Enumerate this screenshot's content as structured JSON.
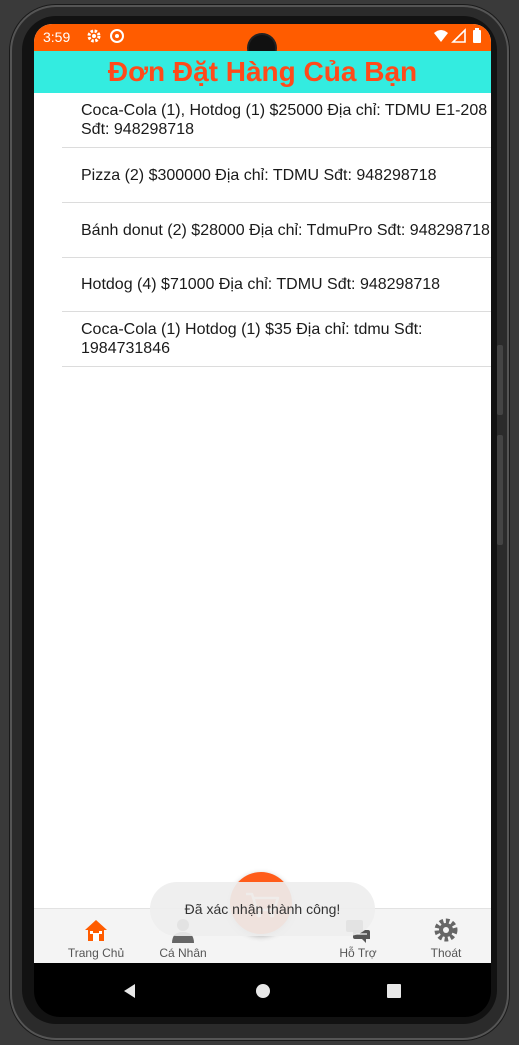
{
  "status_bar": {
    "time": "3:59"
  },
  "app_bar": {
    "title": "Đơn Đặt Hàng Của Bạn"
  },
  "orders": [
    {
      "text": "Coca-Cola (1), Hotdog (1) $25000 Địa chỉ: TDMU E1-208 Sđt: 948298718"
    },
    {
      "text": "Pizza (2) $300000 Địa chỉ: TDMU Sđt: 948298718"
    },
    {
      "text": "Bánh donut (2) $28000 Địa chỉ: TdmuPro Sđt: 948298718"
    },
    {
      "text": "Hotdog (4) $71000 Địa chỉ: TDMU Sđt: 948298718"
    },
    {
      "text": "Coca-Cola (1) Hotdog (1) $35 Địa chỉ: tdmu Sđt: 1984731846"
    }
  ],
  "bottom_nav": {
    "items": [
      {
        "label": "Trang Chủ",
        "icon": "home-icon"
      },
      {
        "label": "Cá Nhân",
        "icon": "person-icon"
      },
      {
        "label": "Hỗ Trợ",
        "icon": "chat-icon"
      },
      {
        "label": "Thoát",
        "icon": "gear-icon"
      }
    ],
    "fab_icon": "cart-icon"
  },
  "toast": {
    "message": "Đã xác nhận thành công!"
  },
  "colors": {
    "status_bar": "#ff5c00",
    "app_bar": "#33ece0",
    "title": "#ff4a1a",
    "fab": "#ff5c1a",
    "home_icon": "#ff5c00"
  },
  "system_nav": {
    "icons": [
      "back-icon",
      "home-circle-icon",
      "recents-icon"
    ]
  }
}
